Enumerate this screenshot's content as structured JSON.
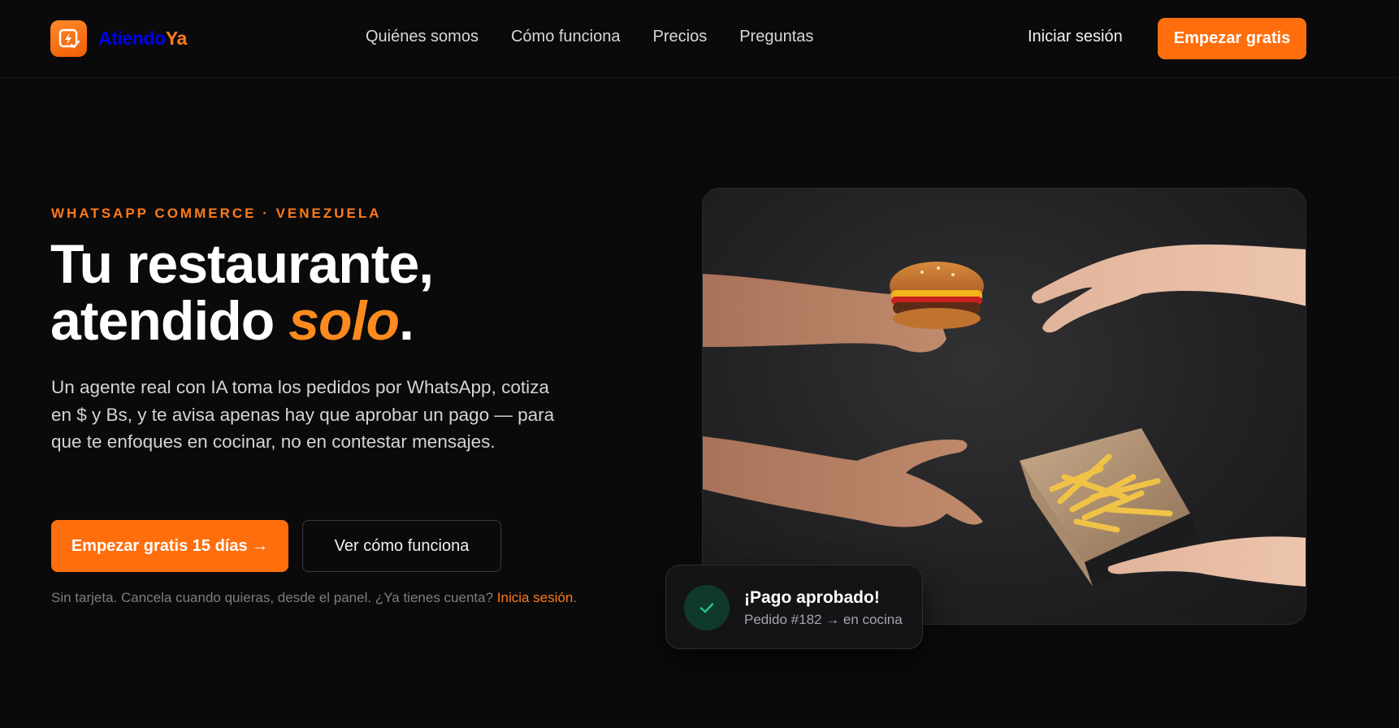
{
  "brand": {
    "name_part1": "Atiendo",
    "name_part2": "Ya",
    "logo_icon": "bolt-check-icon"
  },
  "nav": {
    "items": [
      "Quiénes somos",
      "Cómo funciona",
      "Precios",
      "Preguntas"
    ]
  },
  "header": {
    "login_label": "Iniciar sesión",
    "cta_label": "Empezar gratis"
  },
  "hero": {
    "eyebrow": "WHATSAPP COMMERCE · VENEZUELA",
    "headline_line1": "Tu restaurante,",
    "headline_line2_pre": "atendido ",
    "headline_line2_accent": "solo",
    "headline_line2_post": ".",
    "description": "Un agente real con IA toma los pedidos por WhatsApp, cotiza en $ y Bs, y te avisa apenas hay que aprobar un pago — para que te enfoques en cocinar, no en contestar mensajes.",
    "primary_cta": "Empezar gratis 15 días →",
    "secondary_cta": "Ver cómo funciona",
    "note_text": "Sin tarjeta. Cancela cuando quieras, desde el panel. ¿Ya tienes cuenta? ",
    "note_link": "Inicia sesión",
    "note_end": "."
  },
  "toast": {
    "icon": "check-icon",
    "title": "¡Pago aprobado!",
    "subtitle": "Pedido #182 → en cocina"
  },
  "colors": {
    "accent": "#ff6e0c",
    "background": "#0a0a0b",
    "success": "#22c58b"
  }
}
